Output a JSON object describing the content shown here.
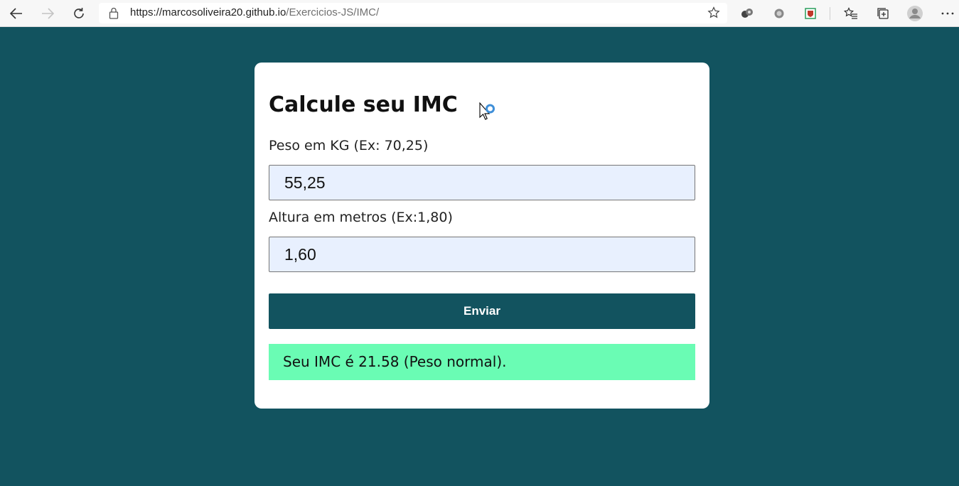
{
  "browser": {
    "url_host": "https://marcosoliveira20.github.io",
    "url_path": "/Exercicios-JS/IMC/"
  },
  "form": {
    "title": "Calcule seu IMC",
    "weight_label": "Peso em KG (Ex: 70,25)",
    "weight_value": "55,25",
    "height_label": "Altura em metros (Ex:1,80)",
    "height_value": "1,60",
    "submit_label": "Enviar",
    "result_text": "Seu IMC é 21.58 (Peso normal)."
  },
  "colors": {
    "page_background": "#12535f",
    "button_background": "#12535f",
    "result_background": "#6afcb4",
    "input_background": "#e8f0fe"
  },
  "icons": [
    "back-icon",
    "forward-icon",
    "refresh-icon",
    "lock-icon",
    "favorite-star-icon",
    "extension-icon",
    "extension-circle-icon",
    "extension-shield-icon",
    "favorites-icon",
    "collections-icon",
    "profile-avatar-icon",
    "more-icon"
  ]
}
